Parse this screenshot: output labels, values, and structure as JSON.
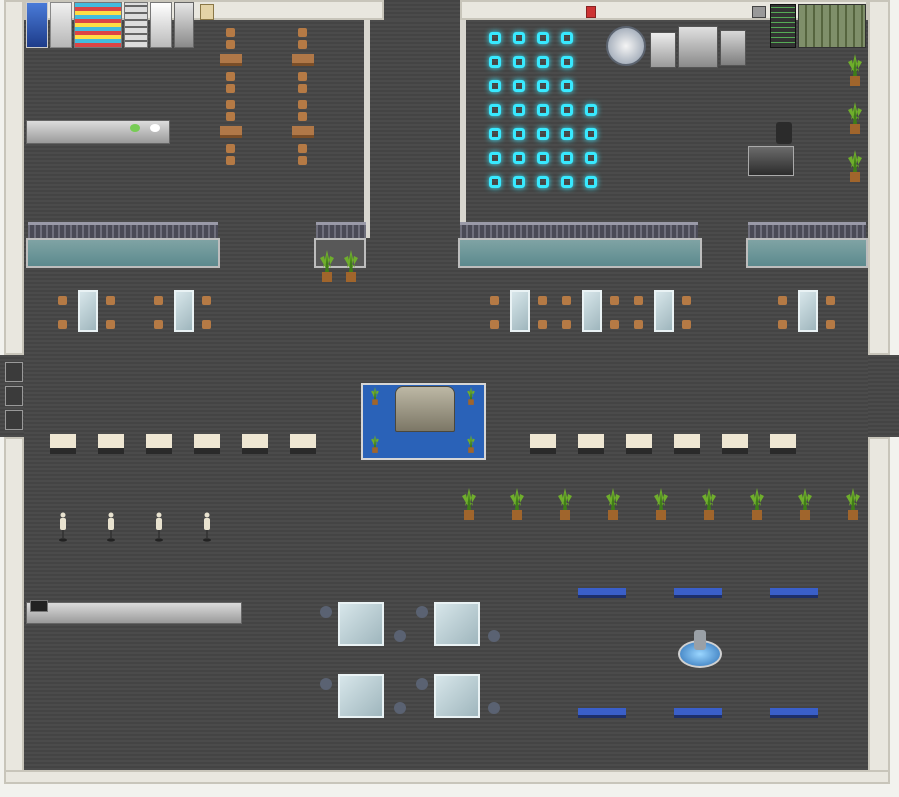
{
  "scene": {
    "type": "top-down RPG tileset map",
    "theme": "modern facility lobby / cafeteria"
  },
  "colors": {
    "outer_wall": "#e9e7df",
    "floor": "#474747",
    "light_tile": "#38e9ff",
    "bench": "#3a5fc9",
    "wood": "#b07848",
    "plant": "#6fae2c"
  },
  "icons": {
    "plant": "potted-plant-icon",
    "fountain": "water-fountain-icon",
    "monument": "stone-monument-icon",
    "machine": "machinery-icon",
    "chair": "office-chair-icon"
  }
}
